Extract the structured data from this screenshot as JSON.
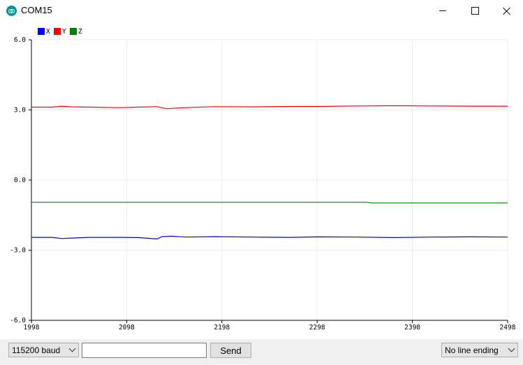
{
  "window": {
    "title": "COM15",
    "icon": "arduino-icon",
    "controls": [
      "minimize-icon",
      "maximize-icon",
      "close-icon"
    ]
  },
  "toolbar": {
    "baud": "115200 baud",
    "send_label": "Send",
    "input_value": "",
    "line_ending": "No line ending"
  },
  "chart_data": {
    "type": "line",
    "xlim": [
      1998,
      2498
    ],
    "ylim": [
      -6.0,
      6.0
    ],
    "x_ticks": [
      "1998",
      "2098",
      "2198",
      "2298",
      "2398",
      "2498"
    ],
    "y_ticks": [
      "6.0",
      "3.0",
      "0.0",
      "-3.0",
      "-6.0"
    ],
    "grid": true,
    "legend_placement": "top-left",
    "series": [
      {
        "name": "X",
        "color": "#0000ff",
        "x": [
          1998,
          2020,
          2030,
          2040,
          2060,
          2090,
          2110,
          2130,
          2135,
          2145,
          2160,
          2190,
          2230,
          2270,
          2300,
          2340,
          2380,
          2420,
          2460,
          2498
        ],
        "y": [
          -2.45,
          -2.45,
          -2.5,
          -2.48,
          -2.45,
          -2.45,
          -2.46,
          -2.52,
          -2.42,
          -2.4,
          -2.44,
          -2.42,
          -2.44,
          -2.45,
          -2.43,
          -2.44,
          -2.46,
          -2.44,
          -2.43,
          -2.44
        ]
      },
      {
        "name": "Y",
        "color": "#ff0000",
        "x": [
          1998,
          2020,
          2030,
          2040,
          2060,
          2090,
          2110,
          2130,
          2140,
          2150,
          2160,
          2190,
          2230,
          2270,
          2300,
          2340,
          2380,
          2420,
          2460,
          2498
        ],
        "y": [
          3.12,
          3.12,
          3.16,
          3.13,
          3.12,
          3.1,
          3.12,
          3.14,
          3.05,
          3.08,
          3.1,
          3.14,
          3.13,
          3.15,
          3.15,
          3.17,
          3.18,
          3.17,
          3.16,
          3.16
        ]
      },
      {
        "name": "Z",
        "color": "#008000",
        "x": [
          1998,
          2100,
          2200,
          2300,
          2350,
          2355,
          2400,
          2498
        ],
        "y": [
          -0.95,
          -0.95,
          -0.95,
          -0.95,
          -0.95,
          -0.98,
          -0.98,
          -0.98
        ]
      }
    ]
  }
}
